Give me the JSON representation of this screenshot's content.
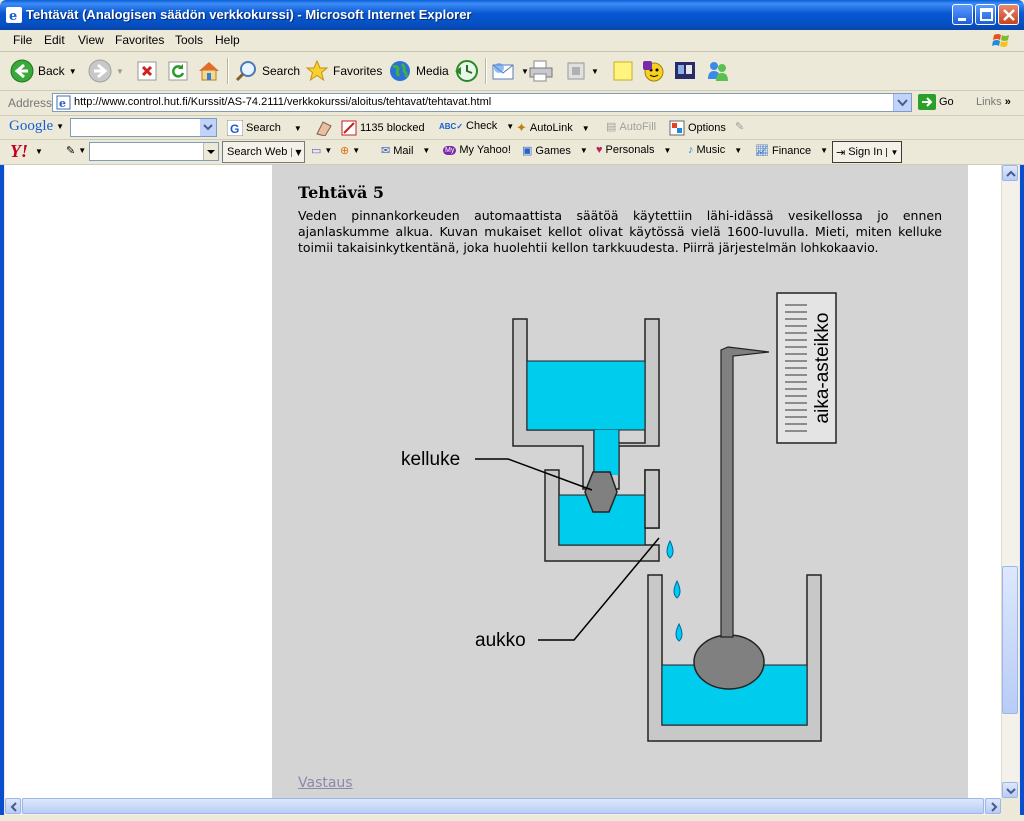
{
  "window": {
    "title": "Tehtävät (Analogisen säädön verkkokurssi) - Microsoft Internet Explorer"
  },
  "menu": [
    "File",
    "Edit",
    "View",
    "Favorites",
    "Tools",
    "Help"
  ],
  "toolbar": {
    "back": "Back",
    "search": "Search",
    "favorites": "Favorites",
    "media": "Media"
  },
  "address": {
    "label": "Address",
    "url": "http://www.control.hut.fi/Kurssit/AS-74.2111/verkkokurssi/aloitus/tehtavat/tehtavat.html",
    "go": "Go",
    "links": "Links"
  },
  "google_bar": {
    "logo": "Google",
    "search": "Search",
    "blocked": "1135 blocked",
    "check": "Check",
    "autolink": "AutoLink",
    "autofill": "AutoFill",
    "options": "Options"
  },
  "yahoo_bar": {
    "logo": "Y!",
    "search_web": "Search Web",
    "mail": "Mail",
    "my_yahoo": "My Yahoo!",
    "games": "Games",
    "personals": "Personals",
    "music": "Music",
    "finance": "Finance",
    "sign_in": "Sign In"
  },
  "page": {
    "task_title": "Tehtävä 5",
    "task_text": "Veden pinnankorkeuden automaattista säätöä käytettiin lähi-idässä vesikellossa jo ennen ajanlaskumme alkua. Kuvan mukaiset kellot olivat käytössä vielä 1600-luvulla. Mieti, miten kelluke toimii takaisinkytkentänä, joka huolehtii kellon tarkkuudesta. Piirrä järjestelmän lohkokaavio.",
    "answer_link": "Vastaus"
  },
  "diagram": {
    "label_float": "kelluke",
    "label_hole": "aukko",
    "label_scale": "aika-asteikko",
    "colors": {
      "water": "#00ccee",
      "wall": "#c8c8c8",
      "float": "#808080"
    }
  }
}
